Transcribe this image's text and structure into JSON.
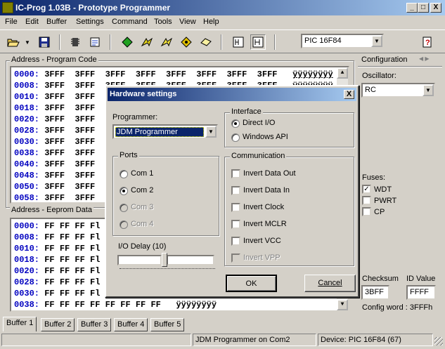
{
  "window": {
    "title": "IC-Prog 1.03B - Prototype Programmer",
    "minimize": "_",
    "maximize": "□",
    "close": "X"
  },
  "menu": [
    "File",
    "Edit",
    "Buffer",
    "Settings",
    "Command",
    "Tools",
    "View",
    "Help"
  ],
  "toolbar": {
    "icons": [
      "open-icon",
      "save-icon",
      "read-chip-icon",
      "write-config-icon",
      "read-icon",
      "program-icon",
      "erase-icon",
      "verify-icon",
      "blank-check-icon",
      "hex-view-icon",
      "asm-view-icon",
      "help-icon"
    ],
    "device": "PIC 16F84"
  },
  "program_code": {
    "label": "Address - Program Code",
    "rows": [
      {
        "addr": "0000:",
        "data": "3FFF  3FFF  3FFF  3FFF  3FFF  3FFF  3FFF  3FFF",
        "ascii": "ÿÿÿÿÿÿÿÿ"
      },
      {
        "addr": "0008:",
        "data": "3FFF  3FFF  3FFF  3FFF  3FFF  3FFF  3FFF  3FFF",
        "ascii": "ÿÿÿÿÿÿÿÿ"
      },
      {
        "addr": "0010:",
        "data": "3FFF  3FFF",
        "ascii": ""
      },
      {
        "addr": "0018:",
        "data": "3FFF  3FFF",
        "ascii": ""
      },
      {
        "addr": "0020:",
        "data": "3FFF  3FFF",
        "ascii": ""
      },
      {
        "addr": "0028:",
        "data": "3FFF  3FFF",
        "ascii": ""
      },
      {
        "addr": "0030:",
        "data": "3FFF  3FFF",
        "ascii": ""
      },
      {
        "addr": "0038:",
        "data": "3FFF  3FFF",
        "ascii": ""
      },
      {
        "addr": "0040:",
        "data": "3FFF  3FFF",
        "ascii": ""
      },
      {
        "addr": "0048:",
        "data": "3FFF  3FFF",
        "ascii": ""
      },
      {
        "addr": "0050:",
        "data": "3FFF  3FFF",
        "ascii": ""
      },
      {
        "addr": "0058:",
        "data": "3FFF  3FFF",
        "ascii": ""
      }
    ]
  },
  "eeprom": {
    "label": "Address - Eeprom Data",
    "rows": [
      {
        "addr": "0000:",
        "data": "FF FF FF Fl",
        "ascii": ""
      },
      {
        "addr": "0008:",
        "data": "FF FF FF Fl",
        "ascii": ""
      },
      {
        "addr": "0010:",
        "data": "FF FF FF Fl",
        "ascii": ""
      },
      {
        "addr": "0018:",
        "data": "FF FF FF Fl",
        "ascii": ""
      },
      {
        "addr": "0020:",
        "data": "FF FF FF Fl",
        "ascii": ""
      },
      {
        "addr": "0028:",
        "data": "FF FF FF Fl",
        "ascii": ""
      },
      {
        "addr": "0030:",
        "data": "FF FF FF Fl",
        "ascii": ""
      },
      {
        "addr": "0038:",
        "data": "FF FF FF FF FF FF FF FF",
        "ascii": "ÿÿÿÿÿÿÿÿ"
      }
    ]
  },
  "config": {
    "label": "Configuration",
    "oscillator_label": "Oscillator:",
    "oscillator": "RC",
    "fuses_label": "Fuses:",
    "fuses": [
      {
        "name": "WDT",
        "checked": true
      },
      {
        "name": "PWRT",
        "checked": false
      },
      {
        "name": "CP",
        "checked": false
      }
    ],
    "checksum_label": "Checksum",
    "checksum": "3BFF",
    "id_label": "ID Value",
    "id_value": "FFFF",
    "config_word": "Config word : 3FFFh"
  },
  "tabs": [
    "Buffer 1",
    "Buffer 2",
    "Buffer 3",
    "Buffer 4",
    "Buffer 5"
  ],
  "status": {
    "programmer": "JDM Programmer on Com2",
    "device": "Device: PIC 16F84  (67)"
  },
  "dialog": {
    "title": "Hardware settings",
    "close": "X",
    "programmer_label": "Programmer:",
    "programmer": "JDM Programmer",
    "interface_label": "Interface",
    "interface_options": [
      {
        "label": "Direct I/O",
        "selected": true
      },
      {
        "label": "Windows API",
        "selected": false
      }
    ],
    "ports_label": "Ports",
    "ports": [
      {
        "label": "Com 1",
        "selected": false,
        "enabled": true
      },
      {
        "label": "Com 2",
        "selected": true,
        "enabled": true
      },
      {
        "label": "Com 3",
        "selected": false,
        "enabled": false
      },
      {
        "label": "Com 4",
        "selected": false,
        "enabled": false
      }
    ],
    "io_delay_label": "I/O Delay (10)",
    "communication_label": "Communication",
    "communication": [
      {
        "label": "Invert Data Out",
        "checked": false,
        "enabled": true
      },
      {
        "label": "Invert Data In",
        "checked": false,
        "enabled": true
      },
      {
        "label": "Invert Clock",
        "checked": false,
        "enabled": true
      },
      {
        "label": "Invert MCLR",
        "checked": false,
        "enabled": true
      },
      {
        "label": "Invert VCC",
        "checked": false,
        "enabled": true
      },
      {
        "label": "Invert VPP",
        "checked": false,
        "enabled": false
      }
    ],
    "ok": "OK",
    "cancel": "Cancel"
  }
}
